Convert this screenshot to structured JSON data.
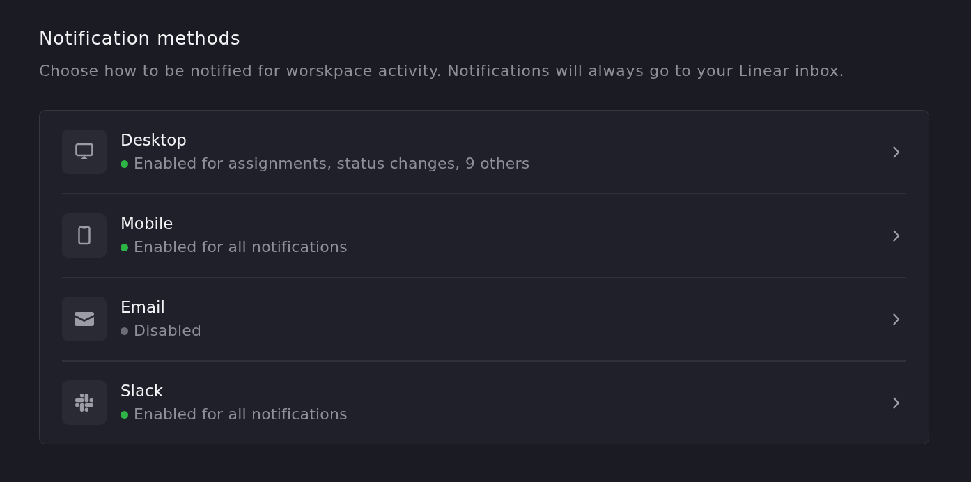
{
  "section": {
    "title": "Notification methods",
    "description": "Choose how to be notified for worskpace activity. Notifications will always go to your Linear inbox."
  },
  "methods": [
    {
      "kind": "desktop",
      "title": "Desktop",
      "status": "Enabled for assignments, status changes, 9 others",
      "color": "#2eb347"
    },
    {
      "kind": "mobile",
      "title": "Mobile",
      "status": "Enabled for all notifications",
      "color": "#2eb347"
    },
    {
      "kind": "email",
      "title": "Email",
      "status": "Disabled",
      "color": "#6c6c76"
    },
    {
      "kind": "slack",
      "title": "Slack",
      "status": "Enabled for all notifications",
      "color": "#2eb347"
    }
  ]
}
